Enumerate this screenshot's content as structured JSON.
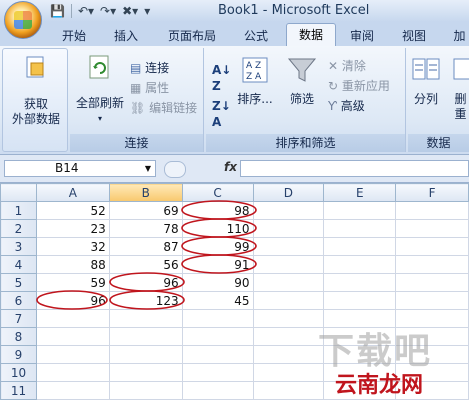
{
  "window": {
    "title": "Book1 - Microsoft Excel"
  },
  "tabs": [
    "开始",
    "插入",
    "页面布局",
    "公式",
    "数据",
    "审阅",
    "视图",
    "加"
  ],
  "active_tab": "数据",
  "ribbon": {
    "get_external": {
      "line1": "获取",
      "line2": "外部数据"
    },
    "refresh_all": "全部刷新",
    "connections": "连接",
    "properties": "属性",
    "edit_links": "编辑链接",
    "group_connections": "连接",
    "sort_label": "排序...",
    "filter_label": "筛选",
    "clear": "清除",
    "reapply": "重新应用",
    "advanced": "高级",
    "group_sort_filter": "排序和筛选",
    "split_columns": "分列",
    "remove_dup_1": "删",
    "remove_dup_2": "重",
    "group_data_tools": "数据"
  },
  "formula_bar": {
    "cell_ref": "B14",
    "fx": "fx",
    "content": ""
  },
  "sheet": {
    "columns": [
      "A",
      "B",
      "C",
      "D",
      "E",
      "F"
    ],
    "rows": [
      {
        "num": "1",
        "cells": [
          "52",
          "69",
          "98",
          "",
          "",
          ""
        ]
      },
      {
        "num": "2",
        "cells": [
          "23",
          "78",
          "110",
          "",
          "",
          ""
        ]
      },
      {
        "num": "3",
        "cells": [
          "32",
          "87",
          "99",
          "",
          "",
          ""
        ]
      },
      {
        "num": "4",
        "cells": [
          "88",
          "56",
          "91",
          "",
          "",
          ""
        ]
      },
      {
        "num": "5",
        "cells": [
          "59",
          "96",
          "90",
          "",
          "",
          ""
        ]
      },
      {
        "num": "6",
        "cells": [
          "96",
          "123",
          "45",
          "",
          "",
          ""
        ]
      },
      {
        "num": "7",
        "cells": [
          "",
          "",
          "",
          "",
          "",
          ""
        ]
      },
      {
        "num": "8",
        "cells": [
          "",
          "",
          "",
          "",
          "",
          ""
        ]
      },
      {
        "num": "9",
        "cells": [
          "",
          "",
          "",
          "",
          "",
          ""
        ]
      },
      {
        "num": "10",
        "cells": [
          "",
          "",
          "",
          "",
          "",
          ""
        ]
      },
      {
        "num": "11",
        "cells": [
          "",
          "",
          "",
          "",
          "",
          ""
        ]
      }
    ]
  },
  "watermark": {
    "text1": "下载吧",
    "text2": "云南龙网"
  },
  "colors": {
    "highlight_circle": "#c0151d",
    "selected_col": "#f8c86d",
    "ribbon_bg": "#dde8f5"
  }
}
